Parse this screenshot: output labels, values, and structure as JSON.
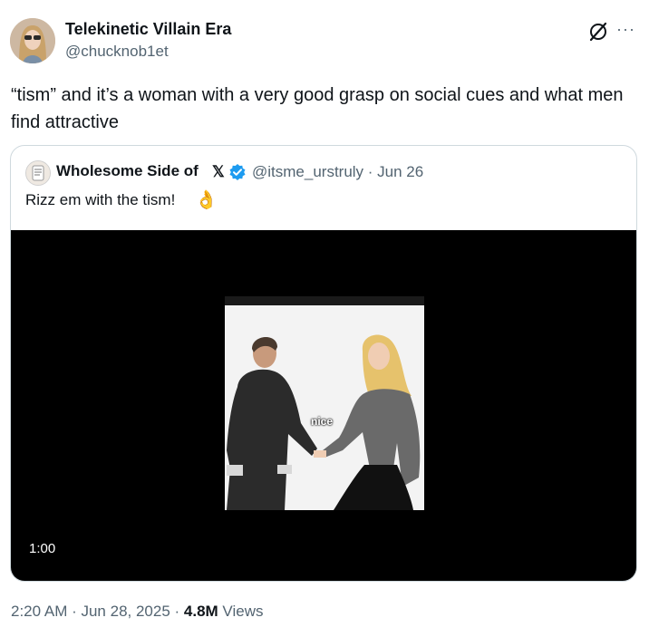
{
  "tweet": {
    "display_name": "Telekinetic Villain Era",
    "handle": "@chucknob1et",
    "text": "“tism” and it’s a woman with a very good grasp on social cues and what men find attractive",
    "more_label": "···"
  },
  "quote": {
    "display_name": "Wholesome Side of",
    "x_glyph": "𝕏",
    "handle_date": "@itsme_urstruly · Jun 26",
    "text": "Rizz em with the tism!",
    "emoji": "👌",
    "video": {
      "caption": "nice",
      "duration": "1:00"
    }
  },
  "footer": {
    "time_date": "2:20 AM · Jun 28, 2025 · ",
    "views_count": "4.8M",
    "views_label": " Views"
  },
  "colors": {
    "text_primary": "#0f1419",
    "text_secondary": "#536471",
    "border": "#cfd9de",
    "verified_blue": "#1d9bf0",
    "video_bg": "#000000"
  }
}
